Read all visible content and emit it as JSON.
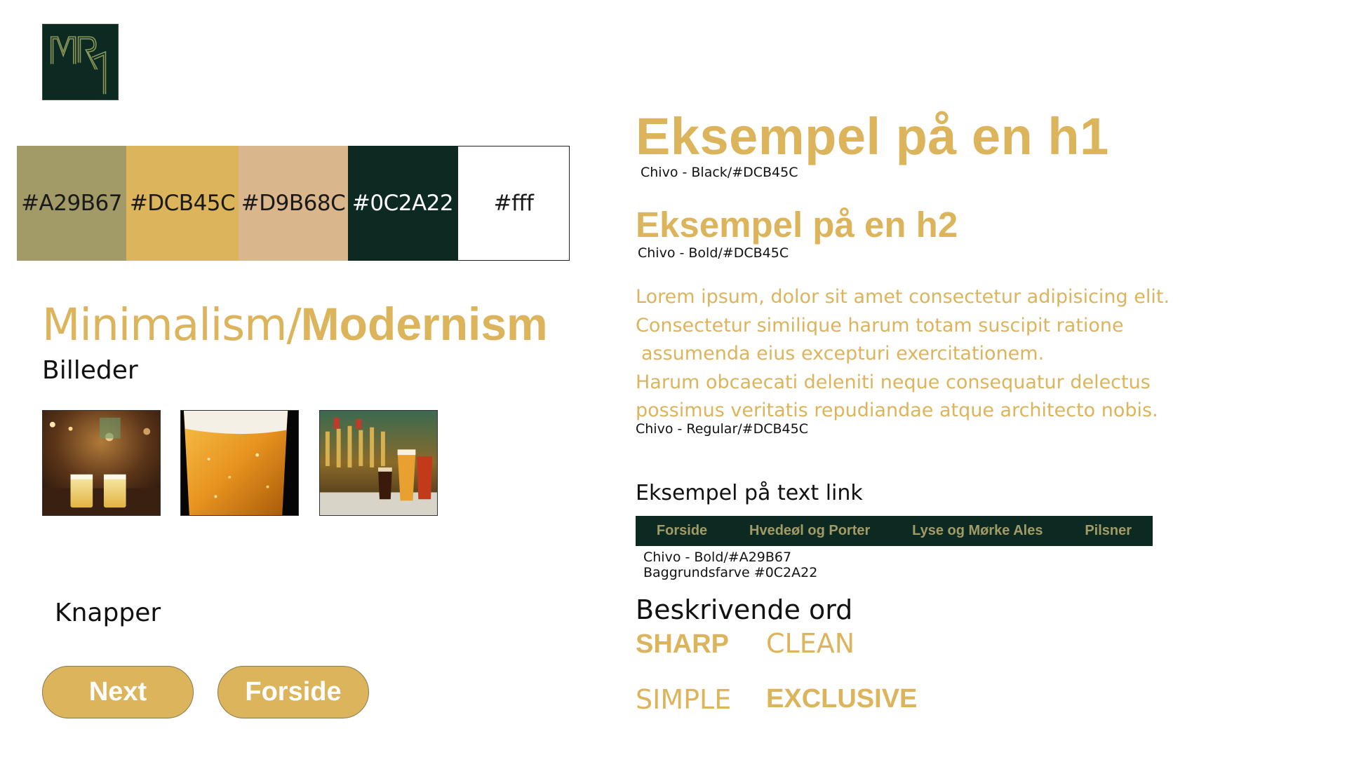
{
  "colors": {
    "olive": "#A29B67",
    "gold": "#DCB45C",
    "tan": "#D9B68C",
    "dark_green": "#0C2A22",
    "white": "#fff"
  },
  "logo": {
    "icon": "mr-monogram-logo"
  },
  "palette": [
    {
      "label": "#A29B67",
      "color": "#A29B67"
    },
    {
      "label": "#DCB45C",
      "color": "#DCB45C"
    },
    {
      "label": "#D9B68C",
      "color": "#D9B68C"
    },
    {
      "label": "#0C2A22",
      "color": "#0C2A22"
    },
    {
      "label": "#fff",
      "color": "#ffffff"
    }
  ],
  "style": {
    "thin": "Minimalism/",
    "bold": "Modernism"
  },
  "images_label": "Billeder",
  "images": [
    {
      "icon": "beer-glasses-bar-photo"
    },
    {
      "icon": "beer-glass-closeup-photo"
    },
    {
      "icon": "beer-taps-photo"
    }
  ],
  "buttons_label": "Knapper",
  "buttons": {
    "next": "Next",
    "forside": "Forside"
  },
  "typography": {
    "h1": "Eksempel på en h1",
    "h1_caption": "Chivo - Black/#DCB45C",
    "h2": "Eksempel på en h2",
    "h2_caption": "Chivo - Bold/#DCB45C",
    "paragraph": [
      "Lorem ipsum, dolor sit amet consectetur adipisicing elit.",
      "Consectetur similique harum totam suscipit ratione",
      "assumenda eius excepturi exercitationem.",
      "Harum obcaecati deleniti neque consequatur delectus",
      "possimus veritatis repudiandae atque architecto nobis."
    ],
    "paragraph_caption": "Chivo - Regular/#DCB45C"
  },
  "text_link": {
    "label": "Eksempel på text link",
    "nav": [
      "Forside",
      "Hvedeøl og Porter",
      "Lyse og Mørke Ales",
      "Pilsner"
    ],
    "caption_1": "Chivo - Bold/#A29B67",
    "caption_2": "Baggrundsfarve #0C2A22"
  },
  "words": {
    "label": "Beskrivende ord",
    "items": [
      "SHARP",
      "CLEAN",
      "SIMPLE",
      "EXCLUSIVE"
    ]
  }
}
